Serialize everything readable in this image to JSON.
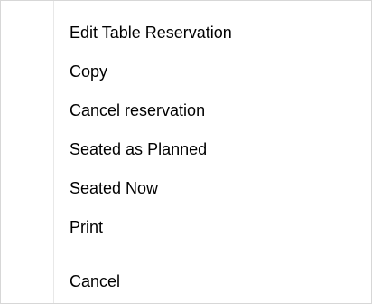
{
  "context_menu": {
    "items": [
      {
        "label": "Edit Table Reservation"
      },
      {
        "label": "Copy"
      },
      {
        "label": "Cancel reservation"
      },
      {
        "label": "Seated as Planned"
      },
      {
        "label": "Seated Now"
      },
      {
        "label": "Print"
      }
    ],
    "footer_item": {
      "label": "Cancel"
    }
  }
}
